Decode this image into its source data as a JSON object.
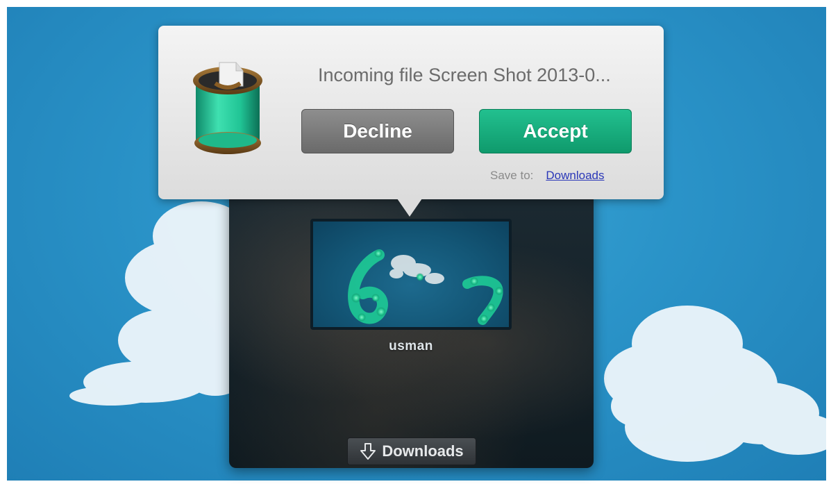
{
  "transfer_prompt": {
    "title": "Incoming file Screen Shot 2013-0...",
    "decline_label": "Decline",
    "accept_label": "Accept",
    "save_to_label": "Save to:",
    "save_location": "Downloads",
    "icon": "file-bucket-icon"
  },
  "peer": {
    "name": "usman"
  },
  "folder_badge": {
    "label": "Downloads",
    "icon": "download-arrow-icon"
  },
  "colors": {
    "sky": "#2a93c8",
    "accept": "#15a877",
    "decline": "#7c7c7c",
    "link": "#2a37b8"
  }
}
